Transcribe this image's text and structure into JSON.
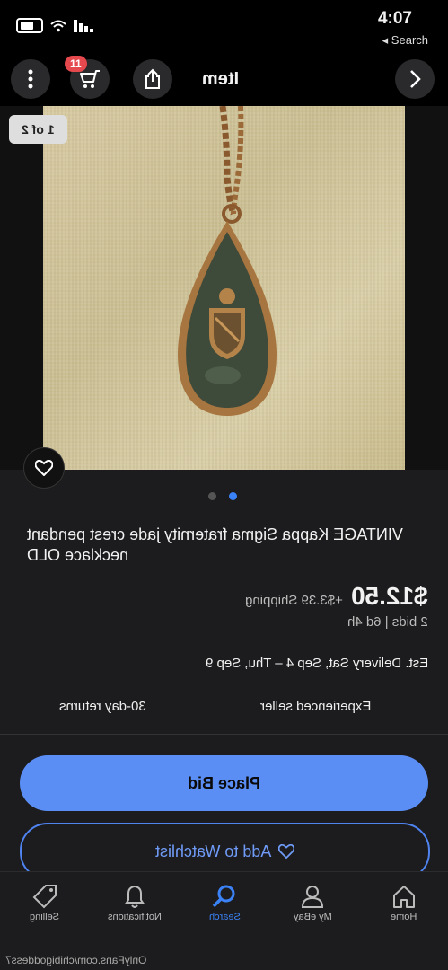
{
  "status": {
    "time": "4:07",
    "back_label": "◂ Search"
  },
  "nav": {
    "title": "Item",
    "cart_count": "11"
  },
  "gallery": {
    "counter": "1 of 2"
  },
  "item": {
    "title": "VINTAGE Kappa Sigma fraternity jade crest pendant necklace OLD",
    "price": "$12.50",
    "shipping": "+$3.39 Shipping",
    "bids": "2 bids  |  6d 4h",
    "delivery": "Est. Delivery Sat, Sep 4 – Thu, Sep 9"
  },
  "features": {
    "seller": "Experienced seller",
    "returns": "30-day returns"
  },
  "actions": {
    "place_bid": "Place Bid",
    "watchlist": "Add to Watchlist"
  },
  "tabs": [
    {
      "label": "Home",
      "icon": "home-icon"
    },
    {
      "label": "My eBay",
      "icon": "person-icon"
    },
    {
      "label": "Search",
      "icon": "search-icon"
    },
    {
      "label": "Notifications",
      "icon": "bell-icon"
    },
    {
      "label": "Selling",
      "icon": "tag-icon"
    }
  ],
  "watermark": "OnlyFans.com/chibigoddess7",
  "colors": {
    "accent": "#3b82f6",
    "button": "#5b8ef5",
    "badge": "#e5484d"
  }
}
